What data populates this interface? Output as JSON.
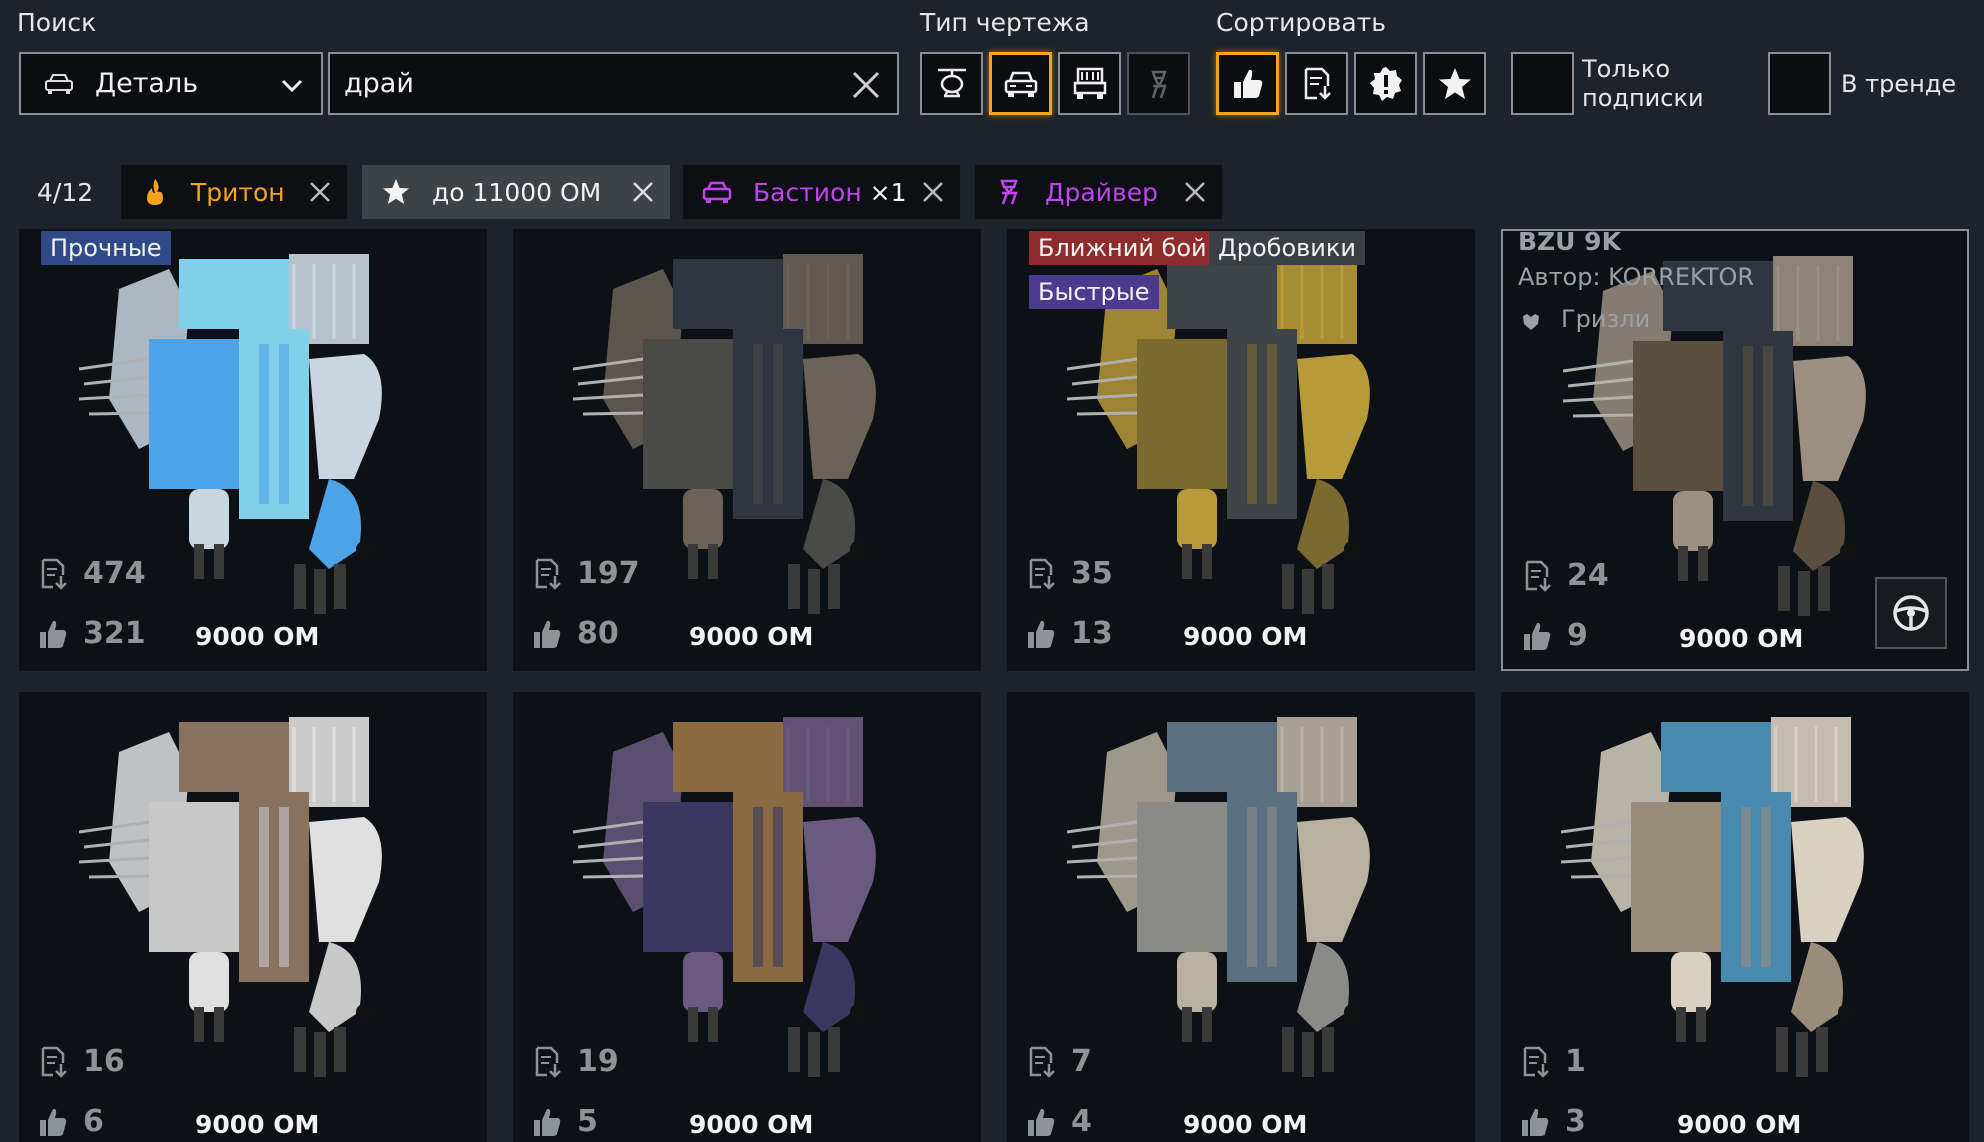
{
  "header": {
    "search_label": "Поиск",
    "type_label": "Тип чертежа",
    "sort_label": "Сортировать"
  },
  "search": {
    "category": "Деталь",
    "query": "драй"
  },
  "blueprint_types": [
    {
      "name": "helicopter-icon",
      "active": false
    },
    {
      "name": "car-icon",
      "active": true
    },
    {
      "name": "truck-icon",
      "active": false
    },
    {
      "name": "walker-icon",
      "active": false
    }
  ],
  "sort_options": [
    {
      "name": "thumbs-up-icon",
      "active": true
    },
    {
      "name": "download-icon",
      "active": false
    },
    {
      "name": "alert-badge-icon",
      "active": false
    },
    {
      "name": "star-icon",
      "active": false
    }
  ],
  "toggles": {
    "subscriptions_only": "Только подписки",
    "trending": "В тренде"
  },
  "filters": {
    "count": "4/12",
    "chips": [
      {
        "label": "Тритон",
        "suffix": "",
        "color": "#f7a21b"
      },
      {
        "label": "до 11000 ОМ",
        "suffix": "",
        "color": "#f2f2f2"
      },
      {
        "label": "Бастион",
        "suffix": " ×1",
        "color": "#c044f0"
      },
      {
        "label": "Драйвер",
        "suffix": "",
        "color": "#c044f0"
      }
    ]
  },
  "colors": {
    "accent_orange": "#f7a21b",
    "accent_purple": "#c044f0",
    "tag_blue": "#2f4a86",
    "tag_red": "#8e2b2b",
    "tag_gray": "#3a3f46",
    "tag_violet": "#4b3a8e"
  },
  "cards": [
    {
      "downloads": "474",
      "likes": "321",
      "price": "9000 ОМ",
      "tags": [
        {
          "text": "Прочные",
          "kind": "blue"
        }
      ],
      "palette": [
        "#4da3e8",
        "#c8d6e0",
        "#7fd0e8"
      ]
    },
    {
      "downloads": "197",
      "likes": "80",
      "price": "9000 ОМ",
      "tags": [],
      "palette": [
        "#4a4a48",
        "#6b6258",
        "#2f3640"
      ]
    },
    {
      "downloads": "35",
      "likes": "13",
      "price": "9000 ОМ",
      "tags": [
        {
          "text": "Ближний бой",
          "kind": "red"
        },
        {
          "text": "Дробовики",
          "kind": "gray"
        },
        {
          "text": "Быстрые",
          "kind": "violet"
        }
      ],
      "palette": [
        "#7a6a30",
        "#b89a3a",
        "#3f4448"
      ]
    },
    {
      "downloads": "24",
      "likes": "9",
      "price": "9000 ОМ",
      "tags": [],
      "title": "BZU 9K",
      "author": "Автор: KORREKTOR",
      "faction": "Гризли",
      "selected": true,
      "palette": [
        "#5a4e40",
        "#9a8f80",
        "#2f3640"
      ]
    },
    {
      "downloads": "16",
      "likes": "6",
      "price": "9000 ОМ",
      "tags": [],
      "palette": [
        "#c8c8c8",
        "#e0e0e0",
        "#8a7260"
      ]
    },
    {
      "downloads": "19",
      "likes": "5",
      "price": "9000 ОМ",
      "tags": [],
      "palette": [
        "#3a3760",
        "#6a5a80",
        "#8a6a40"
      ]
    },
    {
      "downloads": "7",
      "likes": "4",
      "price": "9000 ОМ",
      "tags": [],
      "palette": [
        "#8a8a88",
        "#b8b0a0",
        "#5a7080"
      ]
    },
    {
      "downloads": "1",
      "likes": "3",
      "price": "9000 ОМ",
      "tags": [],
      "palette": [
        "#9a8c7a",
        "#d8d0c0",
        "#4a8ab0"
      ]
    }
  ]
}
